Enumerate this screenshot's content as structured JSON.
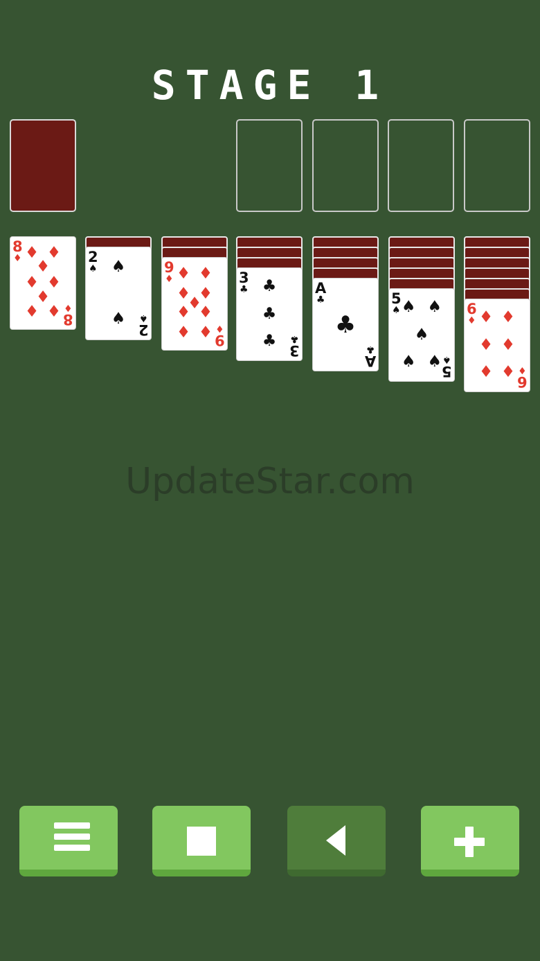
{
  "header": {
    "title": "STAGE 1"
  },
  "stock": {
    "state": "face-down",
    "color": "#6b1a15"
  },
  "foundations": [
    {
      "label": "",
      "state": "empty"
    },
    {
      "label": "",
      "state": "empty"
    },
    {
      "label": "",
      "state": "empty"
    },
    {
      "label": "",
      "state": "empty"
    }
  ],
  "tableau": [
    {
      "hidden": 0,
      "top": {
        "rank": "8",
        "suit": "♦",
        "color": "red"
      }
    },
    {
      "hidden": 1,
      "top": {
        "rank": "2",
        "suit": "♠",
        "color": "black"
      }
    },
    {
      "hidden": 2,
      "top": {
        "rank": "9",
        "suit": "♦",
        "color": "red"
      }
    },
    {
      "hidden": 3,
      "top": {
        "rank": "3",
        "suit": "♣",
        "color": "black"
      }
    },
    {
      "hidden": 4,
      "top": {
        "rank": "A",
        "suit": "♣",
        "color": "black"
      }
    },
    {
      "hidden": 5,
      "top": {
        "rank": "5",
        "suit": "♠",
        "color": "black"
      }
    },
    {
      "hidden": 6,
      "top": {
        "rank": "6",
        "suit": "♦",
        "color": "red"
      }
    }
  ],
  "watermark": "UpdateStar.com",
  "toolbar": {
    "buttons": [
      {
        "icon": "menu-icon",
        "state": "active"
      },
      {
        "icon": "stop-icon",
        "state": "active"
      },
      {
        "icon": "undo-icon",
        "state": "disabled"
      },
      {
        "icon": "plus-icon",
        "state": "active"
      }
    ]
  },
  "colors": {
    "table": "#375432",
    "card_back": "#6b1a15",
    "button": "#82c75f",
    "red_suit": "#e23a2e"
  }
}
